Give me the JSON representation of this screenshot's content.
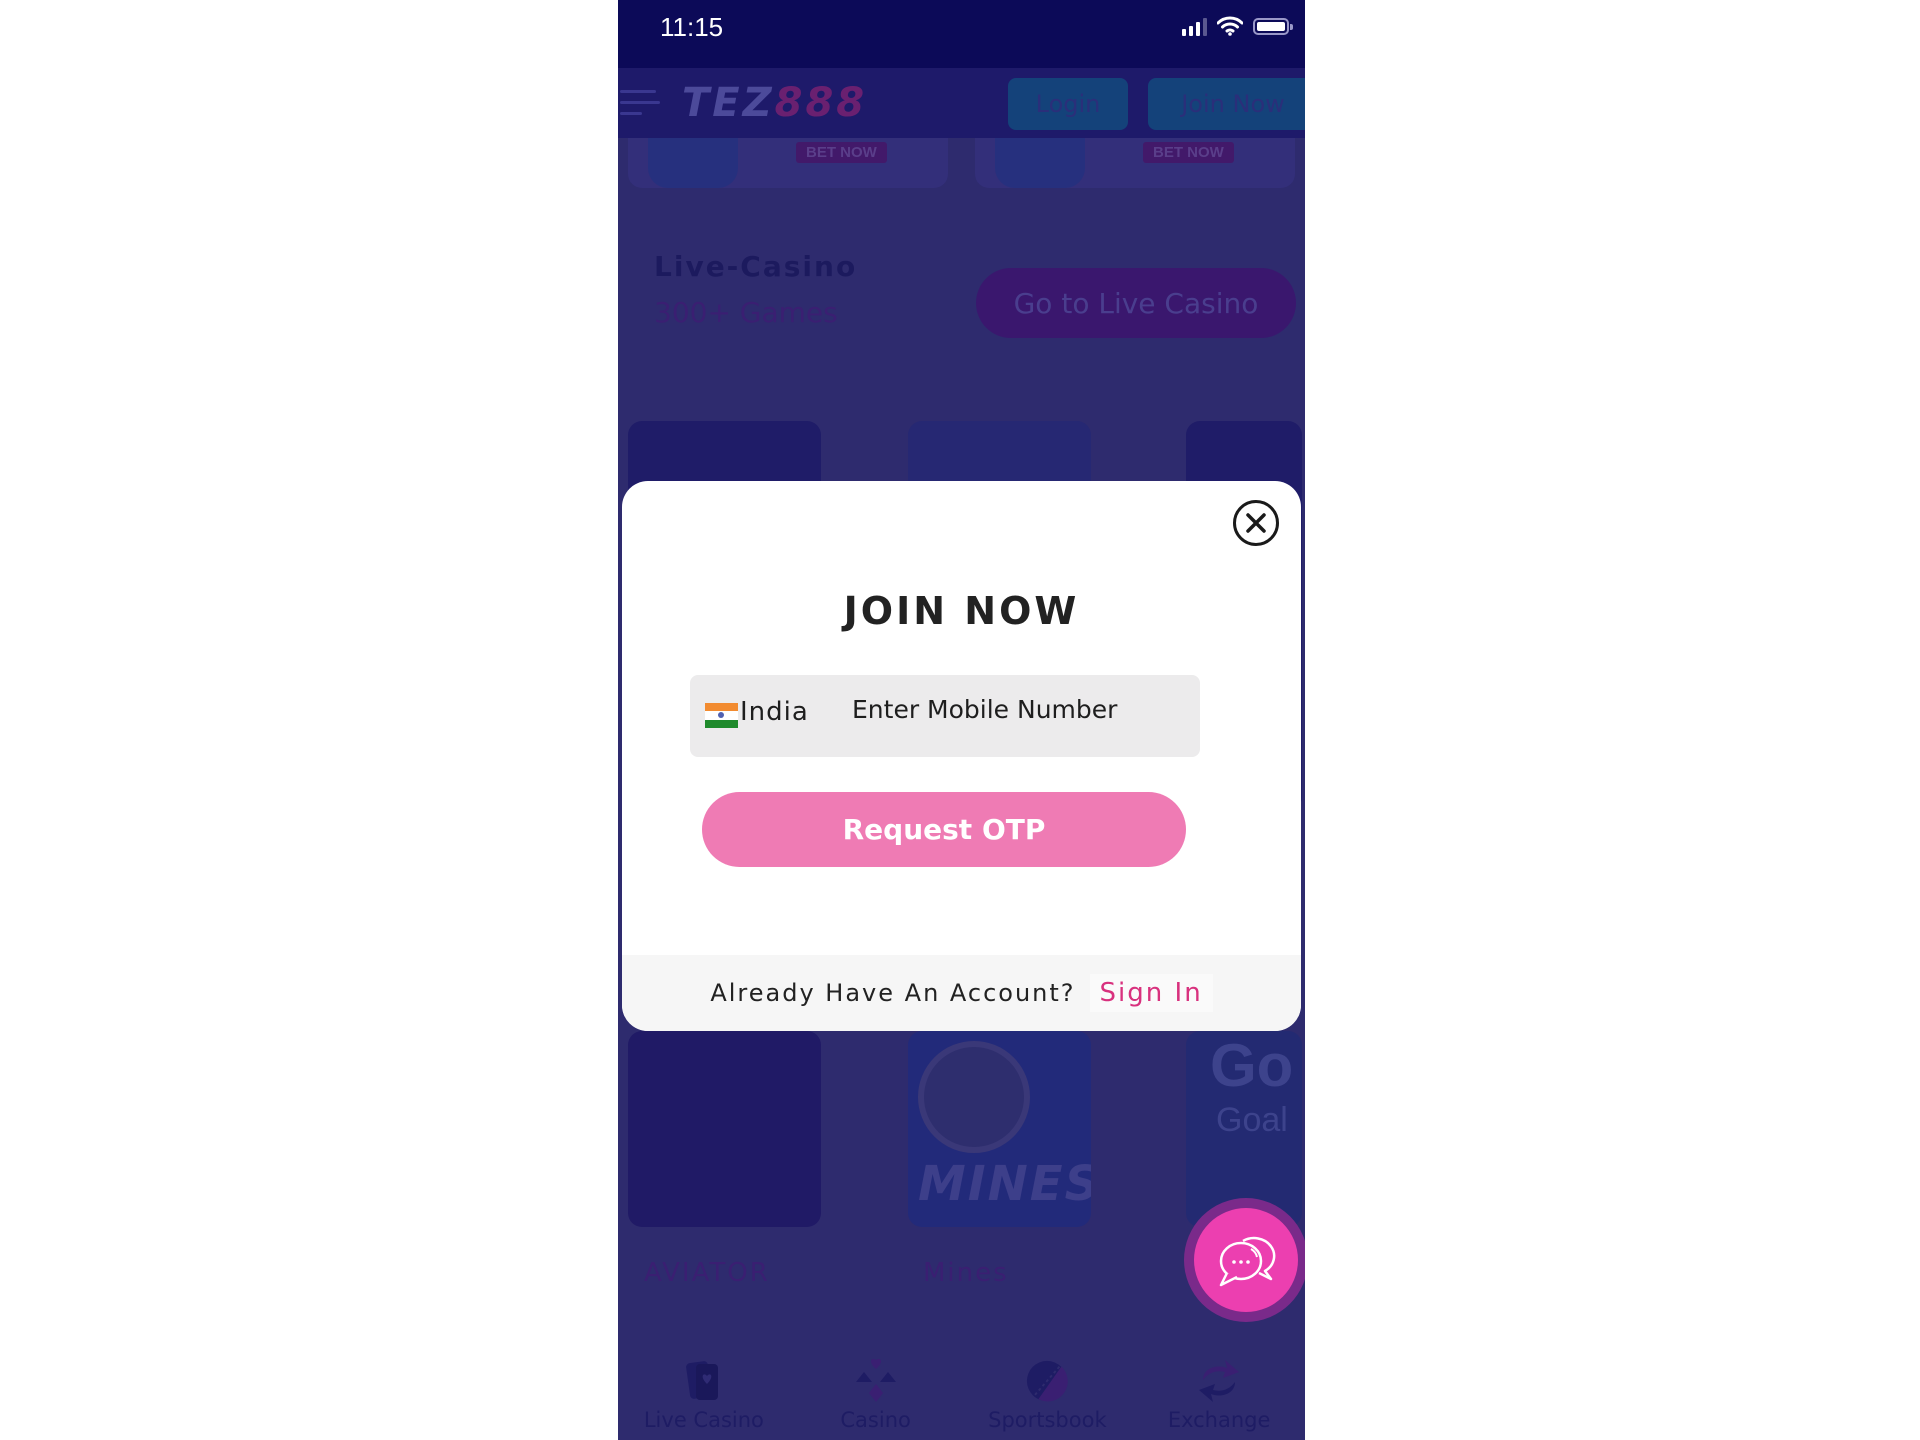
{
  "status_bar": {
    "time": "11:15",
    "icons": [
      "cellular-signal-icon",
      "wifi-icon",
      "battery-icon"
    ]
  },
  "header": {
    "logo_primary": "TEZ",
    "logo_secondary": "888",
    "login_label": "Login",
    "join_label": "Join Now"
  },
  "promos": [
    {
      "cta": "BET NOW"
    },
    {
      "cta": "BET NOW"
    }
  ],
  "live_casino": {
    "title": "Live-Casino",
    "subtitle": "300+ Games",
    "cta": "Go to Live Casino"
  },
  "games": [
    {
      "label": "AVIATOR"
    },
    {
      "label": "Mines",
      "art_text": "MINES"
    },
    {
      "label": "",
      "art_text_top": "Go",
      "art_text_bottom": "Goal"
    }
  ],
  "bottom_nav": [
    {
      "label": "Live Casino",
      "icon": "playing-cards-icon"
    },
    {
      "label": "Casino",
      "icon": "card-suits-icon"
    },
    {
      "label": "Sportsbook",
      "icon": "cricket-ball-icon"
    },
    {
      "label": "Exchange",
      "icon": "exchange-arrows-icon"
    }
  ],
  "modal": {
    "title": "JOIN NOW",
    "country": "India",
    "mobile_placeholder": "Enter Mobile Number",
    "mobile_value": "",
    "request_otp_label": "Request OTP",
    "footer_text": "Already Have An Account?",
    "signin_label": "Sign In"
  },
  "colors": {
    "overlay_bg": "#2e2b6e",
    "status_bar_bg": "#0c0a58",
    "otp_button": "#ef7bb4",
    "signin_link": "#d8317e",
    "chat_fab": "#ec3fb0"
  }
}
